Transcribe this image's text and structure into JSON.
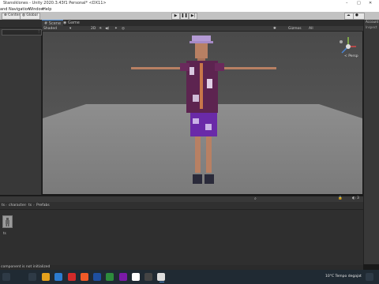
{
  "window": {
    "title": "Stansiklones - Unity 2020.3.43f1 Personal* <DX11>",
    "controls": [
      "–",
      "□",
      "✕"
    ]
  },
  "menu": [
    "and",
    "Navigation",
    "Window",
    "Help"
  ],
  "toolbar": {
    "left_buttons": [
      "Center",
      "Global"
    ],
    "play_icons": [
      "play-icon",
      "pause-icon",
      "step-icon"
    ]
  },
  "tabs": [
    {
      "label": "Scene",
      "active": true
    },
    {
      "label": "Game",
      "active": false
    }
  ],
  "scene_toolbar": {
    "shading": "Shaded",
    "mode": "2D",
    "gizmos": "Gizmos",
    "search": "All"
  },
  "gizmo": {
    "persp_label": "< Persp"
  },
  "project": {
    "breadcrumb": [
      "ts",
      "character",
      "ts",
      "Prefabs"
    ],
    "asset_label": "ts",
    "count": "3"
  },
  "right_panel": {
    "label": "Account",
    "sub": "Inspect"
  },
  "status": {
    "text": "component is not initialized"
  },
  "taskbar": {
    "weather": "10°C  Tempo degajat",
    "colors": [
      "#c8102e",
      "#2b7bd0",
      "#f05a28",
      "#ffcc00",
      "#1e4fa0",
      "#7a1aa8",
      "#3a7bd5",
      "#ffffff",
      "#d12a2a",
      "#2d8c3c",
      "#444444"
    ]
  },
  "accent": "#4a8cd6"
}
